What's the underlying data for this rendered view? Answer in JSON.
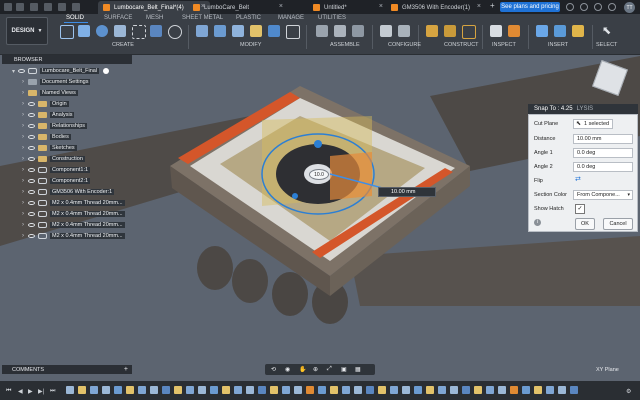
{
  "tabs": [
    {
      "label": "Lumbocare_Belt_Final*(4)",
      "active": true
    },
    {
      "label": "LumboCare_Belt",
      "active": false
    },
    {
      "label": "Untitled*",
      "active": false
    },
    {
      "label": "GM3506 With Encoder(1)",
      "active": false
    }
  ],
  "plans_button": "See plans and pricing",
  "avatar": "TT",
  "workspace": "DESIGN",
  "ws_tabs": [
    "SOLID",
    "SURFACE",
    "MESH",
    "SHEET METAL",
    "PLASTIC",
    "MANAGE",
    "UTILITIES"
  ],
  "groups": [
    "CREATE",
    "MODIFY",
    "ASSEMBLE",
    "CONFIGURE",
    "CONSTRUCT",
    "INSPECT",
    "INSERT",
    "SELECT"
  ],
  "browser": {
    "title": "BROWSER",
    "root": "Lumbocare_Belt_Final",
    "items": [
      "Document Settings",
      "Named Views",
      "Origin",
      "Analysis",
      "Relationships",
      "Bodies",
      "Sketches",
      "Construction",
      "Component1:1",
      "Component2:1",
      "GM3506 With Encoder:1",
      "M2 x 0.4mm Thread 20mm...",
      "M2 x 0.4mm Thread 20mm...",
      "M2 x 0.4mm Thread 20mm...",
      "M2 x 0.4mm Thread 20mm..."
    ]
  },
  "viewport": {
    "dim_label": "10.00 mm",
    "dial_label": "10.0"
  },
  "analysis": {
    "snap": "Snap To : 4.25",
    "header": "LYSIS",
    "cut_plane_label": "Cut Plane",
    "cut_plane_value": "1 selected",
    "distance_label": "Distance",
    "distance_value": "10.00 mm",
    "angle1_label": "Angle 1",
    "angle1_value": "0.0 deg",
    "angle2_label": "Angle 2",
    "angle2_value": "0.0 deg",
    "flip_label": "Flip",
    "section_color_label": "Section Color",
    "section_color_value": "From Compone...",
    "show_hatch_label": "Show Hatch",
    "ok": "OK",
    "cancel": "Cancel"
  },
  "comments": "COMMENTS",
  "status": "XY Plane",
  "colors": {
    "accent": "#1f72d6",
    "orange": "#f08a24",
    "belt": "#54504c",
    "device": "#8c7f73",
    "panel": "#eef0f2"
  }
}
